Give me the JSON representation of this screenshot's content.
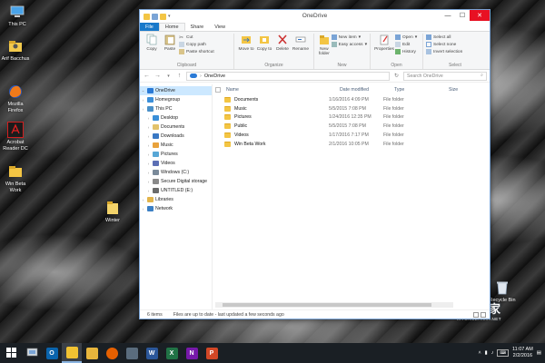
{
  "desktop": {
    "icons": [
      {
        "label": "This PC",
        "icon": "computer-icon"
      },
      {
        "label": "Arif Bacchus",
        "icon": "user-folder-icon"
      },
      {
        "label": "Mozilla Firefox",
        "icon": "firefox-icon"
      },
      {
        "label": "Acrobat Reader DC",
        "icon": "acrobat-icon"
      },
      {
        "label": "Win Beta Work",
        "icon": "folder-icon"
      },
      {
        "label": "Winter",
        "icon": "folder-icon"
      },
      {
        "label": "Recycle Bin",
        "icon": "recycle-bin-icon"
      }
    ]
  },
  "window": {
    "title": "OneDrive",
    "controls": {
      "minimize": "—",
      "maximize": "☐",
      "close": "✕"
    },
    "tabs": [
      "File",
      "Home",
      "Share",
      "View"
    ],
    "ribbon": {
      "clipboard": {
        "name": "Clipboard",
        "copy": "Copy",
        "paste": "Paste",
        "cut": "Cut",
        "copy_path": "Copy path",
        "paste_shortcut": "Paste shortcut"
      },
      "organize": {
        "name": "Organize",
        "move_to": "Move to",
        "copy_to": "Copy to",
        "delete": "Delete",
        "rename": "Rename"
      },
      "new": {
        "name": "New",
        "new_folder": "New folder",
        "new_item": "New item",
        "easy_access": "Easy access"
      },
      "open": {
        "name": "Open",
        "properties": "Properties",
        "open": "Open",
        "edit": "Edit",
        "history": "History"
      },
      "select": {
        "name": "Select",
        "select_all": "Select all",
        "select_none": "Select none",
        "invert": "Invert selection"
      }
    },
    "address": {
      "back": "←",
      "forward": "→",
      "up": "↑",
      "path": "OneDrive",
      "search_placeholder": "Search OneDrive"
    },
    "nav": [
      {
        "label": "OneDrive",
        "level": 0,
        "selected": true,
        "icon": "cloud-icon",
        "color": "#2a7ad6"
      },
      {
        "label": "Homegroup",
        "level": 0,
        "selected": false,
        "icon": "homegroup-icon",
        "color": "#3b8fd9"
      },
      {
        "label": "This PC",
        "level": 0,
        "selected": false,
        "icon": "computer-icon",
        "color": "#4a90c8"
      },
      {
        "label": "Desktop",
        "level": 1,
        "selected": false,
        "icon": "desktop-icon",
        "color": "#3a8fd8"
      },
      {
        "label": "Documents",
        "level": 1,
        "selected": false,
        "icon": "documents-icon",
        "color": "#e2c26b"
      },
      {
        "label": "Downloads",
        "level": 1,
        "selected": false,
        "icon": "downloads-icon",
        "color": "#3a78c4"
      },
      {
        "label": "Music",
        "level": 1,
        "selected": false,
        "icon": "music-icon",
        "color": "#e8a23c"
      },
      {
        "label": "Pictures",
        "level": 1,
        "selected": false,
        "icon": "pictures-icon",
        "color": "#58a7d6"
      },
      {
        "label": "Videos",
        "level": 1,
        "selected": false,
        "icon": "videos-icon",
        "color": "#5c6fb5"
      },
      {
        "label": "Windows (C:)",
        "level": 1,
        "selected": false,
        "icon": "drive-icon",
        "color": "#7a8a9a"
      },
      {
        "label": "Secure Digital storage",
        "level": 1,
        "selected": false,
        "icon": "sd-card-icon",
        "color": "#8a8a8a"
      },
      {
        "label": "UNTITLED (E:)",
        "level": 1,
        "selected": false,
        "icon": "usb-drive-icon",
        "color": "#6a6a6a"
      },
      {
        "label": "Libraries",
        "level": 0,
        "selected": false,
        "icon": "libraries-icon",
        "color": "#e2b44a"
      },
      {
        "label": "Network",
        "level": 0,
        "selected": false,
        "icon": "network-icon",
        "color": "#3b7fc4"
      }
    ],
    "columns": {
      "name": "Name",
      "date": "Date modified",
      "type": "Type",
      "size": "Size"
    },
    "files": [
      {
        "name": "Documents",
        "date": "1/16/2016 4:09 PM",
        "type": "File folder"
      },
      {
        "name": "Music",
        "date": "5/5/2015 7:08 PM",
        "type": "File folder"
      },
      {
        "name": "Pictures",
        "date": "1/24/2016 12:35 PM",
        "type": "File folder"
      },
      {
        "name": "Public",
        "date": "5/5/2015 7:08 PM",
        "type": "File folder"
      },
      {
        "name": "Videos",
        "date": "1/17/2016 7:17 PM",
        "type": "File folder"
      },
      {
        "name": "Win Beta Work",
        "date": "2/1/2016 10:05 PM",
        "type": "File folder"
      }
    ],
    "status": {
      "count": "6 items",
      "sync": "Files are up to date - last updated a few seconds ago"
    }
  },
  "taskbar": {
    "apps": [
      {
        "icon": "start-icon"
      },
      {
        "icon": "task-view-icon"
      },
      {
        "icon": "outlook-icon",
        "letter": "O",
        "color": "#0a64ad"
      },
      {
        "icon": "file-explorer-icon",
        "color": "#f1c232",
        "active": true
      },
      {
        "icon": "folder-icon",
        "color": "#e7b53c"
      },
      {
        "icon": "firefox-icon",
        "color": "#e66000"
      },
      {
        "icon": "settings-icon",
        "color": "#5a6c7d"
      },
      {
        "icon": "word-icon",
        "letter": "W",
        "color": "#2b579a"
      },
      {
        "icon": "excel-icon",
        "letter": "X",
        "color": "#217346"
      },
      {
        "icon": "onenote-icon",
        "letter": "N",
        "color": "#7719aa"
      },
      {
        "icon": "powerpoint-icon",
        "letter": "P",
        "color": "#d24726"
      }
    ],
    "time": "11:07 AM",
    "date": "2/2/2016"
  },
  "watermark": {
    "main": "系统之家",
    "sub": "XITONGZHIJIA.NET"
  }
}
